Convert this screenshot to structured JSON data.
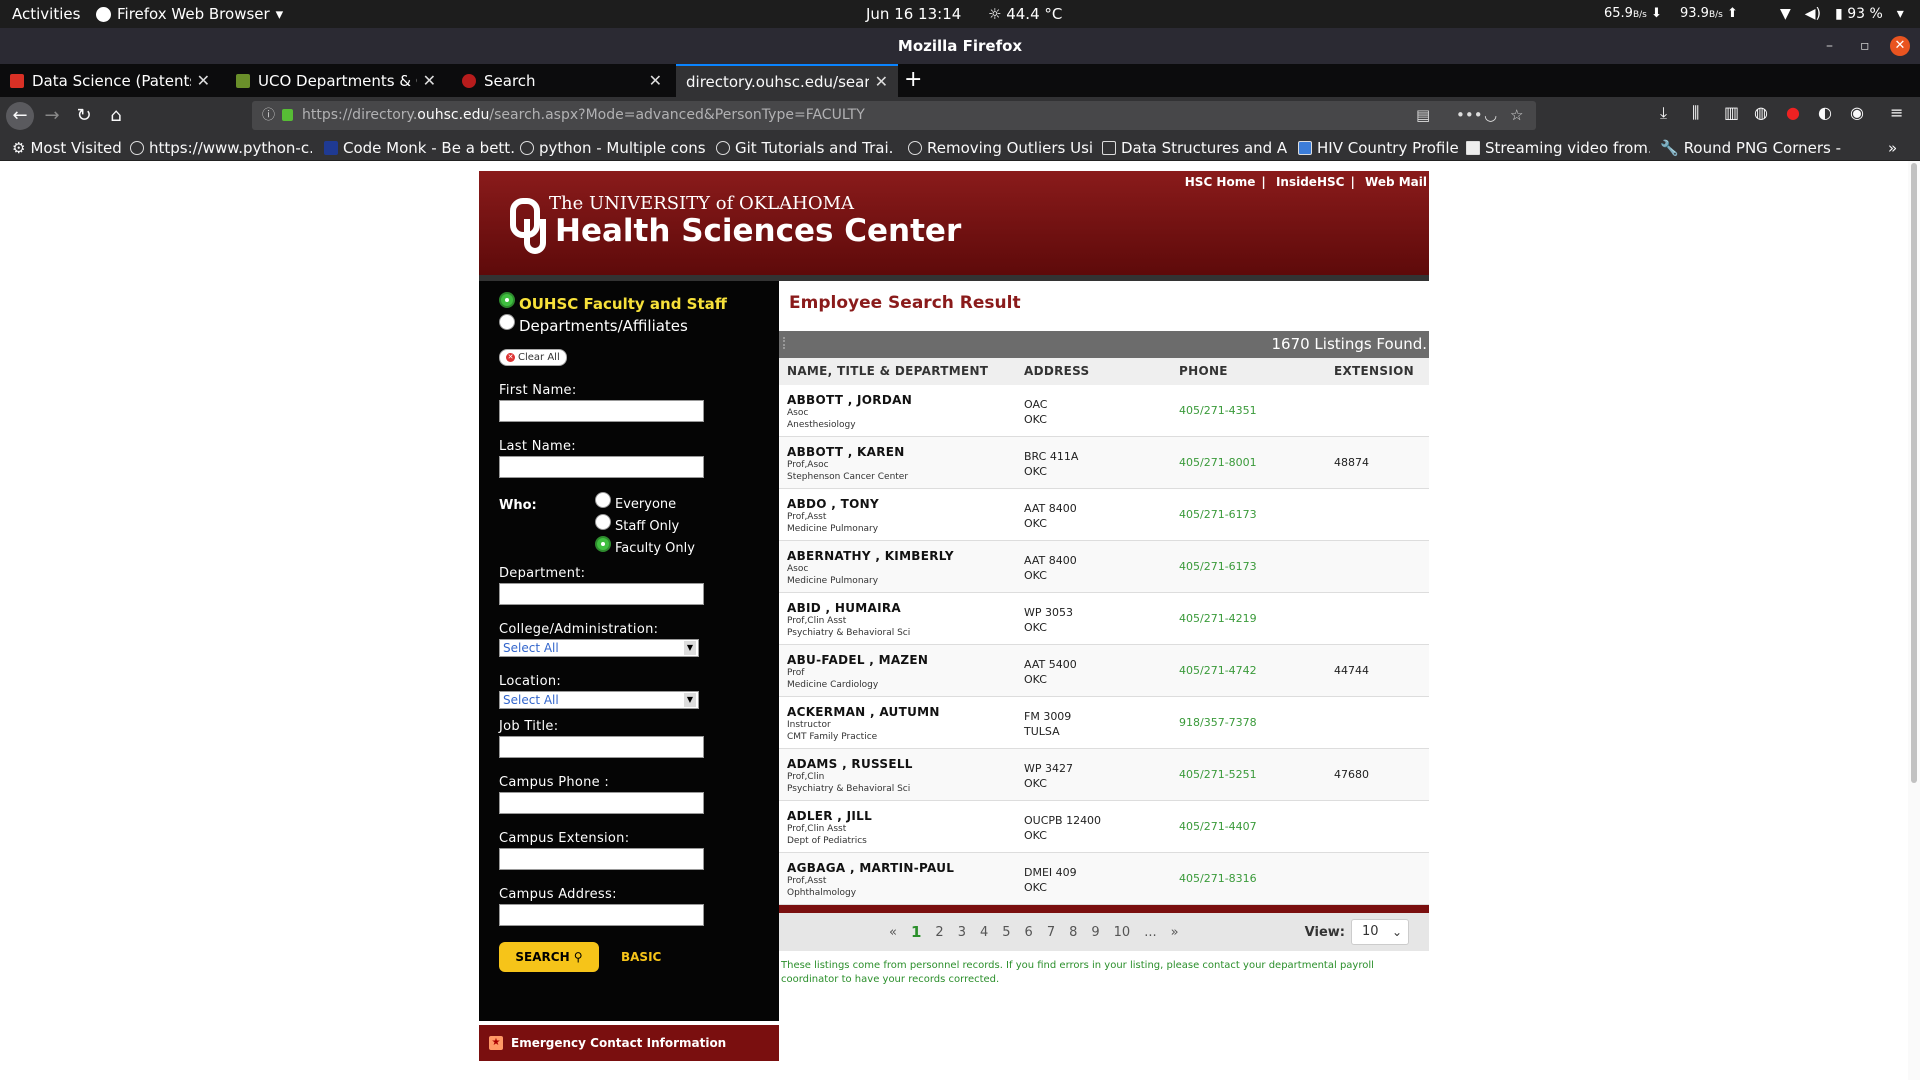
{
  "os": {
    "activities": "Activities",
    "app_name": "Firefox Web Browser",
    "datetime": "Jun 16  13:14",
    "weather": "44.4 °C",
    "net_down": "65.9",
    "net_down_unit": "B/s",
    "net_up": "93.9",
    "net_up_unit": "B/s",
    "battery": "93 %"
  },
  "window": {
    "title": "Mozilla Firefox"
  },
  "tabs": [
    {
      "label": "Data Science (Patents) I",
      "favicon_color": "#d93025"
    },
    {
      "label": "UCO Departments & Off",
      "favicon_color": "#6a8f2a"
    },
    {
      "label": "Search",
      "favicon_color": "#b71c1c"
    },
    {
      "label": "directory.ouhsc.edu/search",
      "favicon_color": ""
    }
  ],
  "nav": {
    "url_prefix": "https://directory.",
    "url_host": "ouhsc.edu",
    "url_suffix": "/search.aspx?Mode=advanced&PersonType=FACULTY"
  },
  "bookmarks": [
    "Most Visited",
    "https://www.python-c...",
    "Code Monk - Be a bett...",
    "python - Multiple cons...",
    "Git Tutorials and Trai...",
    "Removing Outliers Usi...",
    "Data Structures and A...",
    "HIV Country Profiles",
    "Streaming video from...",
    "Round PNG Corners - ..."
  ],
  "header": {
    "title_top": "The UNIVERSITY of OKLAHOMA",
    "title_main": "Health Sciences Center",
    "links": [
      "HSC Home",
      "InsideHSC",
      "Web Mail"
    ]
  },
  "sidebar": {
    "mode_options": [
      "OUHSC Faculty and Staff",
      "Departments/Affiliates"
    ],
    "clear_all": "Clear All",
    "first_name_label": "First Name:",
    "last_name_label": "Last Name:",
    "who_label": "Who:",
    "who_options": [
      "Everyone",
      "Staff Only",
      "Faculty Only"
    ],
    "department_label": "Department:",
    "college_label": "College/Administration:",
    "college_value": "Select All",
    "location_label": "Location:",
    "location_value": "Select All",
    "job_title_label": "Job Title:",
    "campus_phone_label": "Campus Phone :",
    "campus_ext_label": "Campus Extension:",
    "campus_address_label": "Campus Address:",
    "search_button": "SEARCH",
    "basic_link": "BASIC",
    "emergency": "Emergency Contact Information"
  },
  "results": {
    "title": "Employee Search Result",
    "found": "1670 Listings Found.",
    "columns": [
      "NAME, TITLE & DEPARTMENT",
      "ADDRESS",
      "PHONE",
      "EXTENSION"
    ],
    "rows": [
      {
        "name": "ABBOTT , JORDAN",
        "title": "Asoc",
        "dept": "Anesthesiology",
        "addr1": "OAC",
        "addr2": "OKC",
        "phone": "405/271-4351",
        "ext": ""
      },
      {
        "name": "ABBOTT , KAREN",
        "title": "Prof,Asoc",
        "dept": "Stephenson Cancer Center",
        "addr1": "BRC 411A",
        "addr2": "OKC",
        "phone": "405/271-8001",
        "ext": "48874"
      },
      {
        "name": "ABDO , TONY",
        "title": "Prof,Asst",
        "dept": "Medicine Pulmonary",
        "addr1": "AAT 8400",
        "addr2": "OKC",
        "phone": "405/271-6173",
        "ext": ""
      },
      {
        "name": "ABERNATHY , KIMBERLY",
        "title": "Asoc",
        "dept": "Medicine Pulmonary",
        "addr1": "AAT 8400",
        "addr2": "OKC",
        "phone": "405/271-6173",
        "ext": ""
      },
      {
        "name": "ABID , HUMAIRA",
        "title": "Prof,Clin Asst",
        "dept": "Psychiatry & Behavioral Sci",
        "addr1": "WP 3053",
        "addr2": "OKC",
        "phone": "405/271-4219",
        "ext": ""
      },
      {
        "name": "ABU-FADEL , MAZEN",
        "title": "Prof",
        "dept": "Medicine Cardiology",
        "addr1": "AAT 5400",
        "addr2": "OKC",
        "phone": "405/271-4742",
        "ext": "44744"
      },
      {
        "name": "ACKERMAN , AUTUMN",
        "title": "Instructor",
        "dept": "CMT Family Practice",
        "addr1": "FM 3009",
        "addr2": "TULSA",
        "phone": "918/357-7378",
        "ext": ""
      },
      {
        "name": "ADAMS , RUSSELL",
        "title": "Prof,Clin",
        "dept": "Psychiatry & Behavioral Sci",
        "addr1": "WP 3427",
        "addr2": "OKC",
        "phone": "405/271-5251",
        "ext": "47680"
      },
      {
        "name": "ADLER , JILL",
        "title": "Prof,Clin Asst",
        "dept": "Dept of Pediatrics",
        "addr1": "OUCPB 12400",
        "addr2": "OKC",
        "phone": "405/271-4407",
        "ext": ""
      },
      {
        "name": "AGBAGA , MARTIN-PAUL",
        "title": "Prof,Asst",
        "dept": "Ophthalmology",
        "addr1": "DMEI 409",
        "addr2": "OKC",
        "phone": "405/271-8316",
        "ext": ""
      }
    ],
    "pager": {
      "first": "«",
      "pages": [
        "1",
        "2",
        "3",
        "4",
        "5",
        "6",
        "7",
        "8",
        "9",
        "10",
        "..."
      ],
      "last": "»",
      "view_label": "View:",
      "view_value": "10"
    },
    "disclaimer": "These listings come from personnel records. If you find errors in your listing, please contact your departmental payroll coordinator to have your records corrected."
  }
}
